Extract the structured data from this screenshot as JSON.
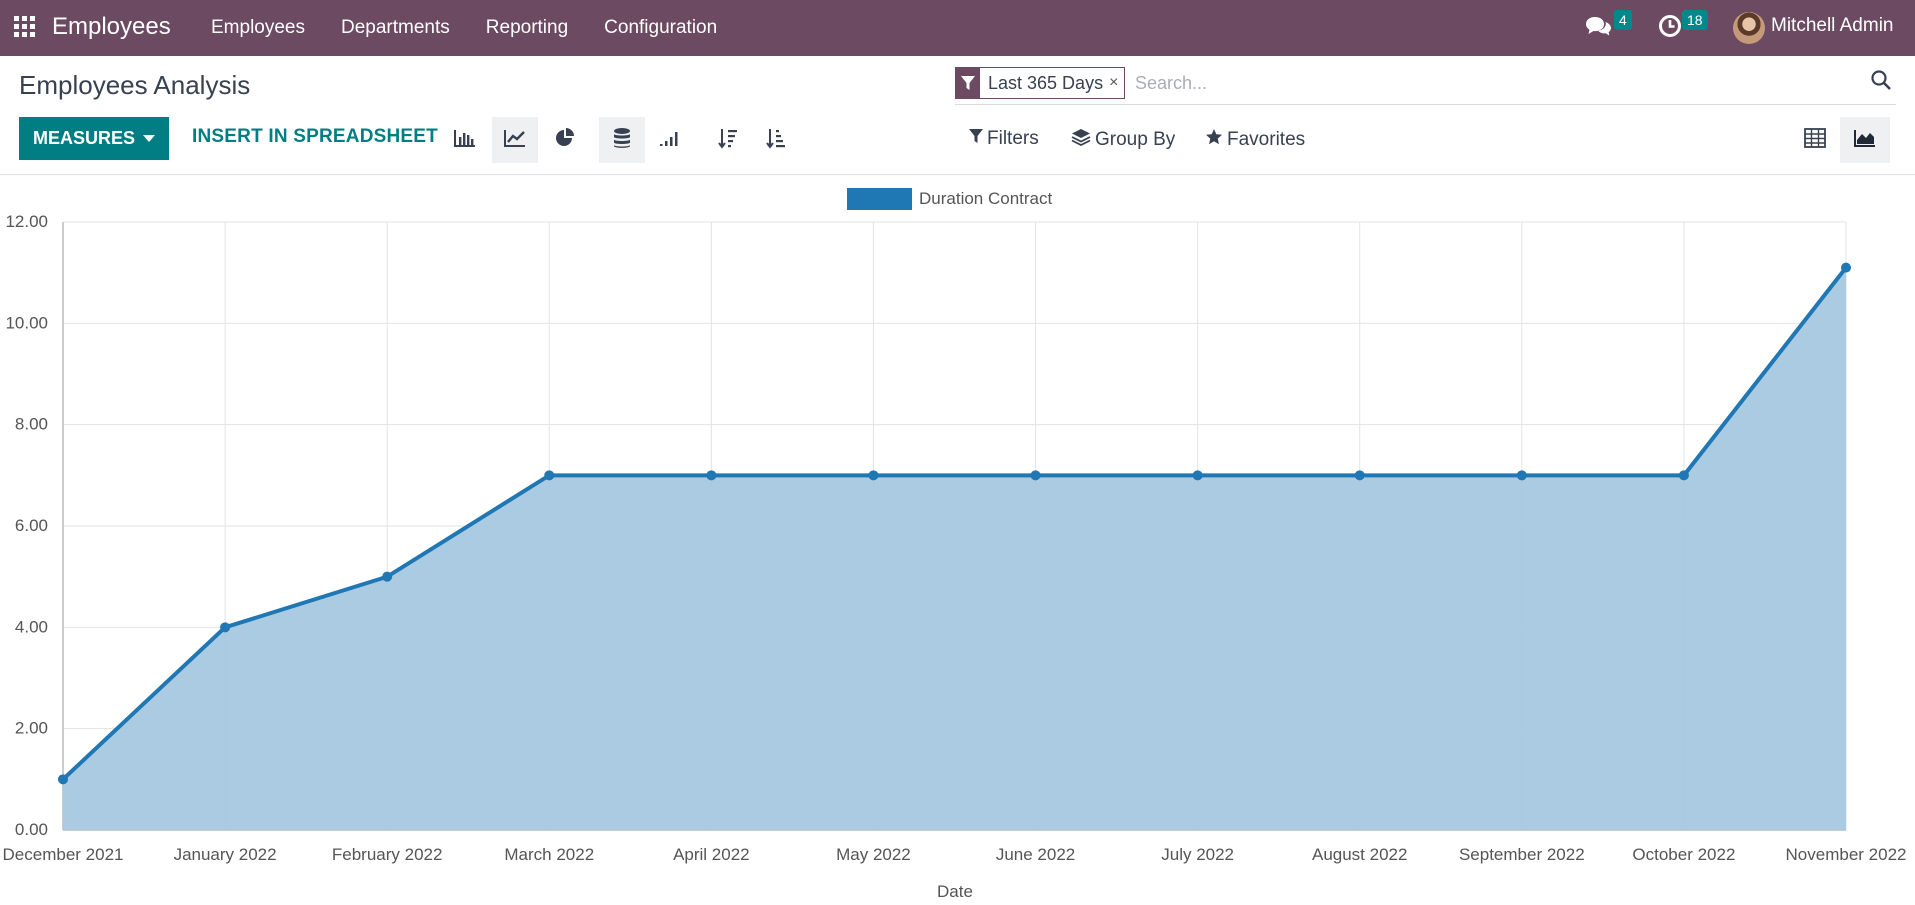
{
  "navbar": {
    "app_title": "Employees",
    "menu": [
      "Employees",
      "Departments",
      "Reporting",
      "Configuration"
    ],
    "messages_count": "4",
    "activities_count": "18",
    "user_name": "Mitchell Admin"
  },
  "control_panel": {
    "title": "Employees Analysis",
    "measures_label": "MEASURES",
    "spreadsheet_label": "INSERT IN SPREADSHEET",
    "facet_label": "Last 365 Days",
    "facet_remove": "×",
    "search_placeholder": "Search...",
    "filters_label": "Filters",
    "groupby_label": "Group By",
    "favorites_label": "Favorites"
  },
  "colors": {
    "navbar": "#6b4a62",
    "accent": "#017e84",
    "series_line": "#1f77b4",
    "series_fill": "#a6c8e0"
  },
  "chart_data": {
    "type": "area",
    "categories": [
      "December 2021",
      "January 2022",
      "February 2022",
      "March 2022",
      "April 2022",
      "May 2022",
      "June 2022",
      "July 2022",
      "August 2022",
      "September 2022",
      "October 2022",
      "November 2022"
    ],
    "series": [
      {
        "name": "Duration Contract",
        "values": [
          1,
          4,
          5,
          7,
          7,
          7,
          7,
          7,
          7,
          7,
          7,
          11.1
        ]
      }
    ],
    "xlabel": "Date",
    "ylabel": "",
    "ylim": [
      0,
      12
    ],
    "yticks": [
      "0.00",
      "2.00",
      "4.00",
      "6.00",
      "8.00",
      "10.00",
      "12.00"
    ],
    "grid": true,
    "legend_position": "top-center"
  }
}
